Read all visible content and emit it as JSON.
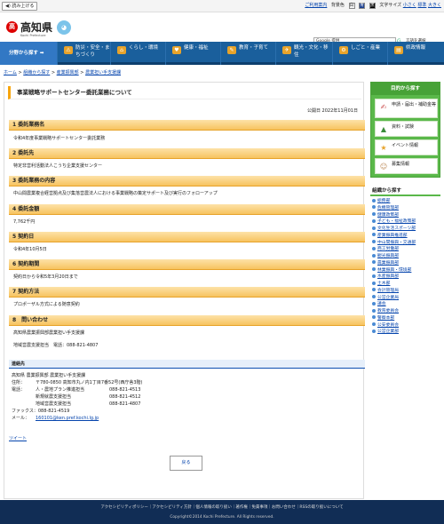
{
  "topbar": {
    "read_aloud": "◀) 読み上げる",
    "help": "ご利用案内",
    "bg_label": "背景色",
    "bg_white": "白",
    "bg_blue": "青",
    "bg_black": "黒",
    "font_label": "文字サイズ",
    "font_small": "小さく",
    "font_normal": "標準",
    "font_large": "大きく"
  },
  "header": {
    "logo_mark": "高",
    "logo_text": "高知県",
    "logo_sub": "Kochi Prefecture",
    "mascot": "◕",
    "search_placeholder": "Google 提供",
    "search_icon": "G",
    "lang": "言語を選択"
  },
  "nav": {
    "category_button": "分野から探す ➡",
    "items": [
      {
        "label": "防災・安全・まちづくり",
        "icon": "⚠",
        "color": "#e7a32b"
      },
      {
        "label": "くらし・環境",
        "icon": "⌂",
        "color": "#e7a32b"
      },
      {
        "label": "健康・福祉",
        "icon": "♥",
        "color": "#e7a32b"
      },
      {
        "label": "教育・子育て",
        "icon": "✎",
        "color": "#e7a32b"
      },
      {
        "label": "観光・文化・移住",
        "icon": "✈",
        "color": "#e7a32b"
      },
      {
        "label": "しごと・産業",
        "icon": "⚙",
        "color": "#e7a32b"
      },
      {
        "label": "県政情報",
        "icon": "▤",
        "color": "#e7a32b"
      }
    ]
  },
  "breadcrumb": {
    "home": "ホーム",
    "sep": ">",
    "org": "組織から探す",
    "dept": "産業振興部",
    "section": "農業担い手支援課"
  },
  "page": {
    "title": "事業戦略サポートセンター委託業務について",
    "published": "公開日 2022年11月01日"
  },
  "sections": [
    {
      "heading": "1 委託業務名",
      "value": "令和4年度事業戦略サポートセンター委託業務"
    },
    {
      "heading": "2 委託先",
      "value": "特定非営利活動法人こうち企業支援センター"
    },
    {
      "heading": "3 委託業務の内容",
      "value": "中山間農業複合経営拠点及び集落営農法人における事業戦略の策定サポート及び実行のフォローアップ"
    },
    {
      "heading": "4 委託金額",
      "value": "7,762千円"
    },
    {
      "heading": "5 契約日",
      "value": "令和4年10月5日"
    },
    {
      "heading": "6 契約期間",
      "value": "契約日から令和5年3月20日まで"
    },
    {
      "heading": "7 契約方法",
      "value": "プロポーザル方式による随意契約"
    },
    {
      "heading": "8　問い合わせ",
      "value": "高知県農業振興部農業担い手支援課",
      "value2": "地域営農支援担当　電話：088-821-4807"
    }
  ],
  "contact": {
    "heading": "連絡先",
    "org": "高知県 農業振興部 農業担い手支援課",
    "address_label": "住所：",
    "address": "〒780-0850 高知市丸ノ内1丁目7番52号(西庁舎3階)",
    "phone_label": "電話：",
    "phones": [
      {
        "unit": "人・農地プラン推進担当",
        "number": "088-821-4513"
      },
      {
        "unit": "新規就農支援担当",
        "number": "088-821-4512"
      },
      {
        "unit": "地域営農支援担当",
        "number": "088-821-4807"
      }
    ],
    "fax": "ファックス：088-821-4519",
    "mail_label": "メール：",
    "mail": "160101@ken.pref.kochi.lg.jp"
  },
  "tweet": "ツイート",
  "back": "戻る",
  "aside": {
    "purpose_title": "目的から探す",
    "purpose": [
      {
        "label": "申請・届出・補助金等",
        "icon": "✍"
      },
      {
        "label": "資料・試験",
        "icon": "▲"
      },
      {
        "label": "イベント情報",
        "icon": "★"
      },
      {
        "label": "募集情報",
        "icon": "☺"
      }
    ],
    "org_title": "組織から探す",
    "orgs": [
      "総務部",
      "危機管理部",
      "健康政策部",
      "子ども・福祉政策部",
      "文化生活スポーツ部",
      "産業振興推進部",
      "中山間振興・交通部",
      "商工労働部",
      "観光振興部",
      "農業振興部",
      "林業振興・環境部",
      "水産振興部",
      "土木部",
      "会計管理局",
      "公営企業局",
      "議会",
      "教育委員会",
      "警察本部",
      "公安委員会",
      "公営企業部"
    ]
  },
  "footer": {
    "links": "アクセシビリティポリシー｜アクセシビリティ方針｜個人情報の取り扱い｜著作権｜免責事項｜お問い合わせ｜RSSの取り扱いについて",
    "copyright": "Copyright©2014 Kochi Prefecture. All Rights reserved."
  }
}
